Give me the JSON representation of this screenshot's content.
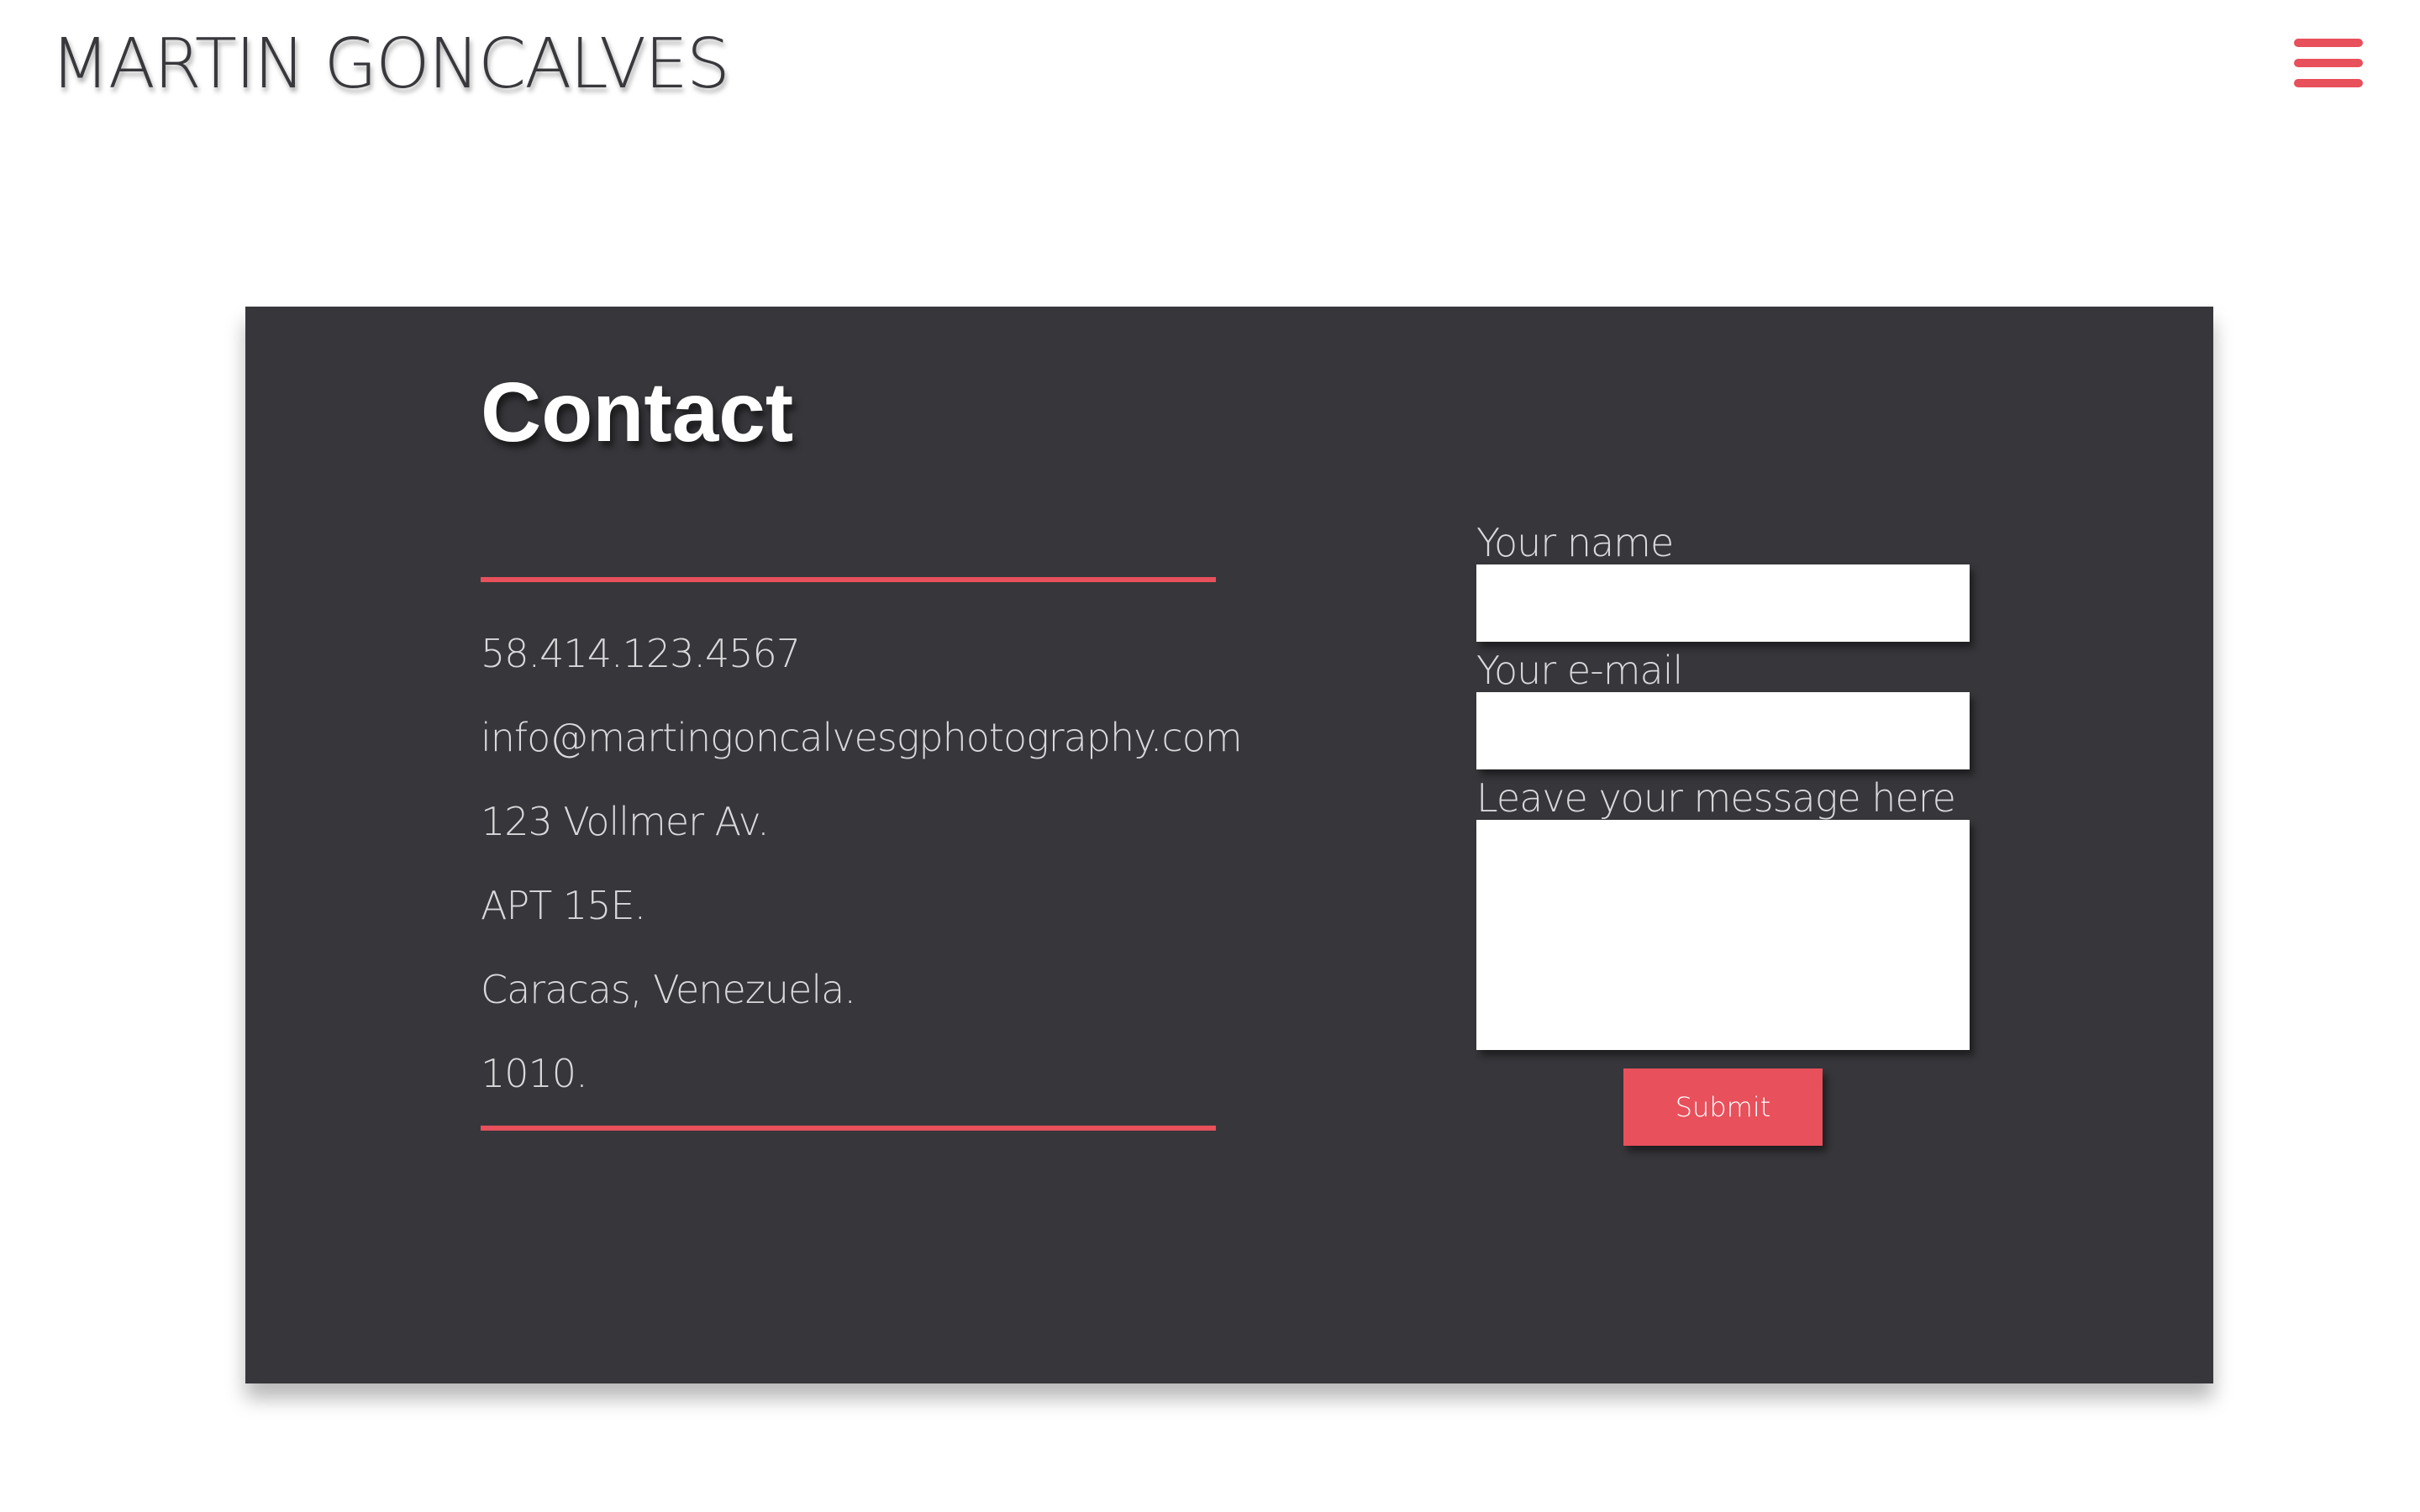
{
  "colors": {
    "accent": "#e8505b",
    "card_background": "#37373b",
    "title_text": "#38383c"
  },
  "header": {
    "site_title": "MARTIN GONCALVES",
    "menu_icon": "hamburger-menu-icon"
  },
  "contact": {
    "title": "Contact",
    "info": {
      "phone": "58.414.123.4567",
      "email": "info@martingoncalvesgphotography.com",
      "address_line1": "123 Vollmer Av.",
      "address_line2": "APT 15E.",
      "city": "Caracas, Venezuela.",
      "postal_code": "1010."
    }
  },
  "form": {
    "name_label": "Your name",
    "name_value": "",
    "email_label": "Your e-mail",
    "email_value": "",
    "message_label": "Leave your message here",
    "message_value": "",
    "submit_label": "Submit"
  }
}
